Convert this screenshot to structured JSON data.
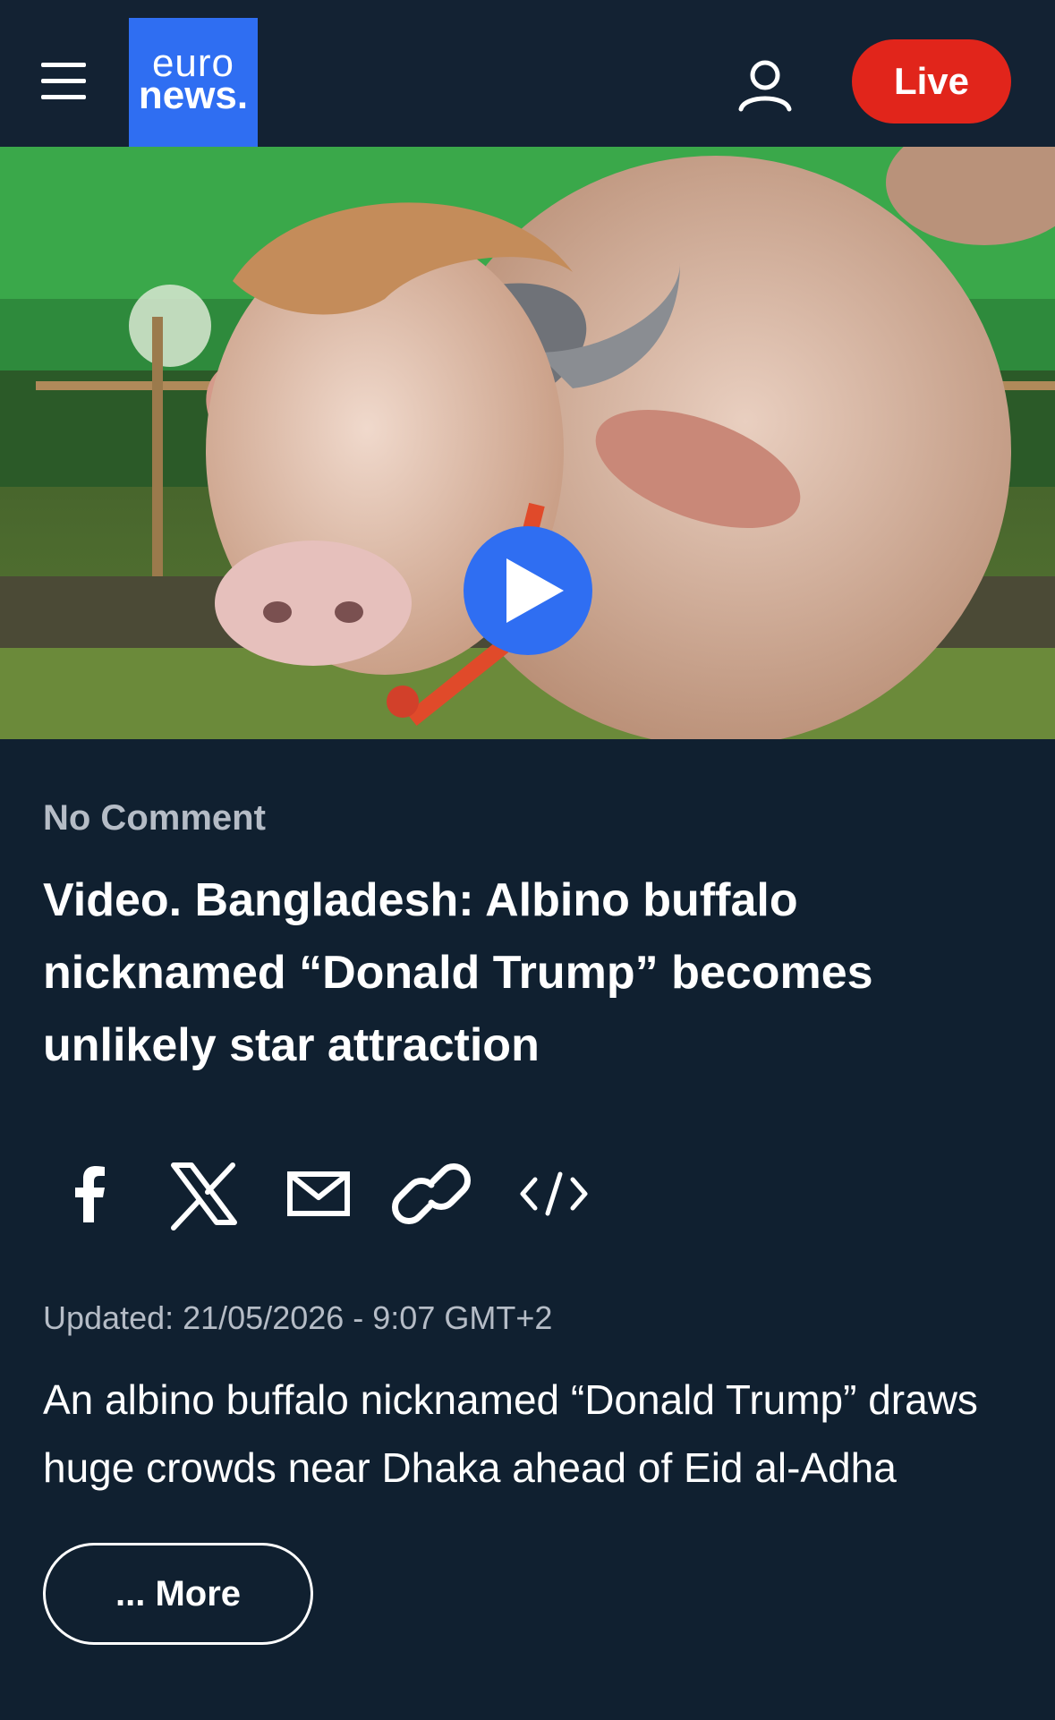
{
  "header": {
    "logo_line1": "euro",
    "logo_line2": "news.",
    "live_label": "Live",
    "menu_icon": "hamburger-menu-icon",
    "user_icon": "user-account-icon"
  },
  "colors": {
    "background": "#102030",
    "header": "#132233",
    "brand_blue": "#2f6ef2",
    "live_red": "#e1251b",
    "muted_text": "#b5bcc6"
  },
  "video": {
    "play_icon": "play-icon"
  },
  "article": {
    "kicker": "No Comment",
    "title": "Video. Bangladesh: Albino buffalo nicknamed “Donald Trump” becomes unlikely star attraction",
    "updated": "Updated: 21/05/2026 - 9:07 GMT+2",
    "summary": "An albino buffalo nicknamed “Donald Trump” draws huge crowds near Dhaka ahead of Eid al-Adha",
    "more_label": "... More"
  },
  "share": [
    {
      "icon": "facebook-icon"
    },
    {
      "icon": "x-icon"
    },
    {
      "icon": "email-icon"
    },
    {
      "icon": "link-icon"
    },
    {
      "icon": "embed-code-icon"
    }
  ]
}
